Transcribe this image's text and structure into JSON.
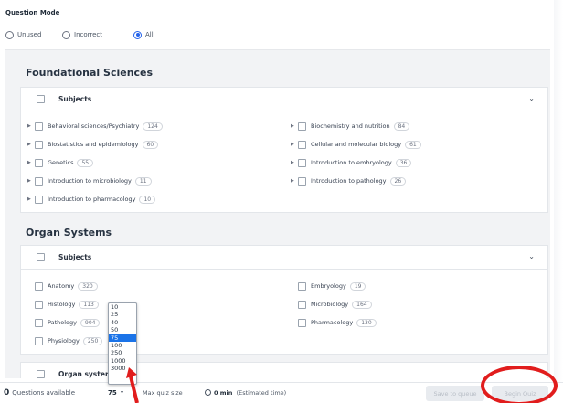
{
  "question_mode": {
    "title": "Question Mode",
    "options": [
      {
        "label": "Unused",
        "selected": false
      },
      {
        "label": "Incorrect",
        "selected": false
      },
      {
        "label": "All",
        "selected": true
      }
    ]
  },
  "foundational": {
    "title": "Foundational Sciences",
    "header_label": "Subjects",
    "items": [
      {
        "name": "Behavioral sciences/Psychiatry",
        "count": "124"
      },
      {
        "name": "Biochemistry and nutrition",
        "count": "84"
      },
      {
        "name": "Biostatistics and epidemiology",
        "count": "60"
      },
      {
        "name": "Cellular and molecular biology",
        "count": "61"
      },
      {
        "name": "Genetics",
        "count": "55"
      },
      {
        "name": "Introduction to embryology",
        "count": "36"
      },
      {
        "name": "Introduction to microbiology",
        "count": "11"
      },
      {
        "name": "Introduction to pathology",
        "count": "26"
      },
      {
        "name": "Introduction to pharmacology",
        "count": "10"
      }
    ]
  },
  "organ": {
    "title": "Organ Systems",
    "header_label": "Subjects",
    "items": [
      {
        "name": "Anatomy",
        "count": "320"
      },
      {
        "name": "Embryology",
        "count": "19"
      },
      {
        "name": "Histology",
        "count": "113"
      },
      {
        "name": "Microbiology",
        "count": "164"
      },
      {
        "name": "Pathology",
        "count": "904"
      },
      {
        "name": "Pharmacology",
        "count": "130"
      },
      {
        "name": "Physiology",
        "count": "250"
      }
    ],
    "systems_label": "Organ systems"
  },
  "dropdown": {
    "options": [
      "10",
      "25",
      "40",
      "50",
      "75",
      "100",
      "250",
      "1000",
      "3000"
    ],
    "selected": "75"
  },
  "bottom": {
    "count": "0",
    "questions_label": "Questions available",
    "quiz_size_value": "75",
    "max_quiz_label": "Max quiz size",
    "time_value": "0 min",
    "time_label": "(Estimated time)",
    "save_label": "Save to queue",
    "begin_label": "Begin Quiz"
  },
  "colors": {
    "accent": "#2563eb",
    "annotation": "#e11d1d",
    "dropdown_highlight": "#1a73e8"
  }
}
